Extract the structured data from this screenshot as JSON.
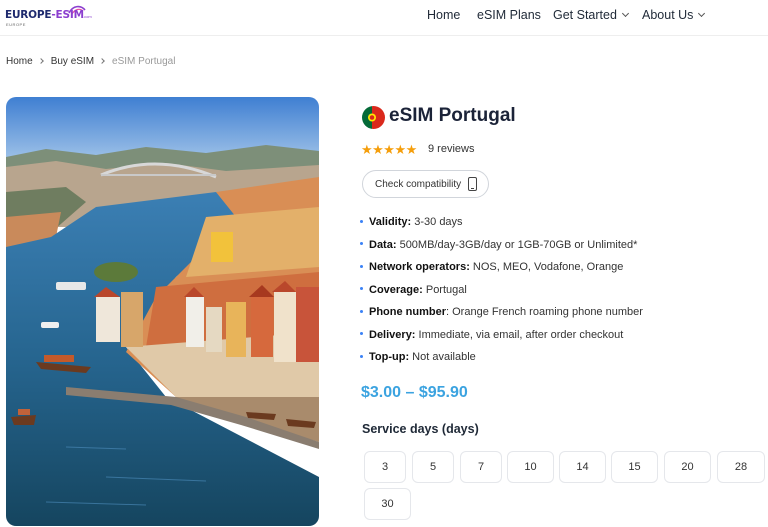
{
  "header": {
    "logo": {
      "main_a": "EUROPE",
      "main_b": "-ESIM",
      "sub": "EUROPE",
      "com": ".com"
    },
    "nav": [
      {
        "label": "Home"
      },
      {
        "label": "eSIM Plans"
      },
      {
        "label": "Get Started",
        "dropdown": true
      },
      {
        "label": "About Us",
        "dropdown": true
      }
    ]
  },
  "breadcrumb": [
    "Home",
    "Buy eSIM",
    "eSIM Portugal"
  ],
  "product": {
    "title": "eSIM Portugal",
    "rating_stars": "★★★★★",
    "rating": 4.5,
    "reviews": "9 reviews",
    "check_button": "Check compatibility",
    "specs": [
      {
        "label": "Validity:",
        "value": " 3-30 days"
      },
      {
        "label": "Data:",
        "value": " 500MB/day-3GB/day or 1GB-70GB or Unlimited*"
      },
      {
        "label": "Network operators:",
        "value": " NOS, MEO, Vodafone, Orange"
      },
      {
        "label": "Coverage:",
        "value": " Portugal"
      },
      {
        "label": "Phone number",
        "value": ": Orange French roaming phone number"
      },
      {
        "label": "Delivery:",
        "value": " Immediate, via email, after order checkout"
      },
      {
        "label": "Top-up:",
        "value": " Not available"
      }
    ],
    "price": "$3.00 – $95.90",
    "service_days_title": "Service days (days)",
    "service_days": [
      "3",
      "5",
      "7",
      "10",
      "14",
      "15",
      "20",
      "28",
      "30"
    ]
  },
  "colors": {
    "accent": "#3ba3e0",
    "star": "#f59e0b",
    "brand": "#1e2a6e"
  }
}
